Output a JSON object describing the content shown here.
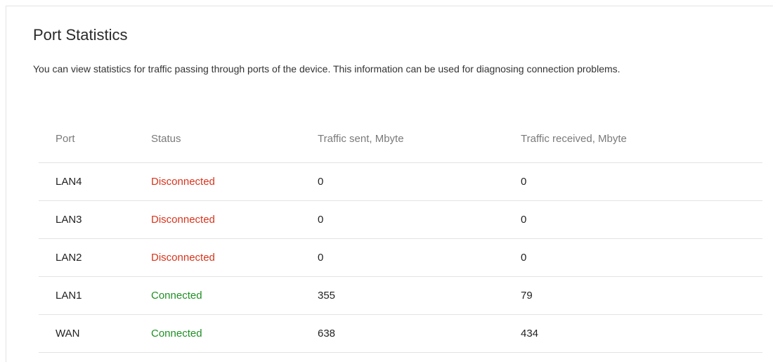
{
  "page": {
    "title": "Port Statistics",
    "description": "You can view statistics for traffic passing through ports of the device. This information can be used for diagnosing connection problems."
  },
  "table": {
    "headers": {
      "port": "Port",
      "status": "Status",
      "sent": "Traffic sent, Mbyte",
      "received": "Traffic received, Mbyte"
    },
    "rows": [
      {
        "port": "LAN4",
        "status": "Disconnected",
        "status_color": "#d9341c",
        "sent": "0",
        "received": "0"
      },
      {
        "port": "LAN3",
        "status": "Disconnected",
        "status_color": "#d9341c",
        "sent": "0",
        "received": "0"
      },
      {
        "port": "LAN2",
        "status": "Disconnected",
        "status_color": "#d9341c",
        "sent": "0",
        "received": "0"
      },
      {
        "port": "LAN1",
        "status": "Connected",
        "status_color": "#1f8f24",
        "sent": "355",
        "received": "79"
      },
      {
        "port": "WAN",
        "status": "Connected",
        "status_color": "#1f8f24",
        "sent": "638",
        "received": "434"
      }
    ]
  }
}
